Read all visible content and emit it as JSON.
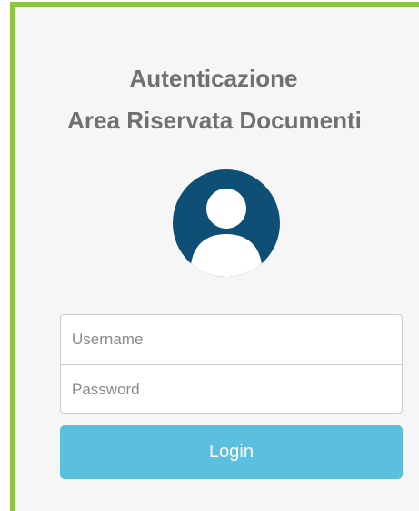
{
  "header": {
    "title_line1": "Autenticazione",
    "title_line2": "Area Riservata Documenti"
  },
  "avatar": {
    "icon": "user-avatar-icon",
    "color": "#0f4f76"
  },
  "form": {
    "username_placeholder": "Username",
    "username_value": "",
    "password_placeholder": "Password",
    "password_value": "",
    "login_label": "Login",
    "login_color": "#5bc0de"
  },
  "accent_color": "#8cc63f"
}
